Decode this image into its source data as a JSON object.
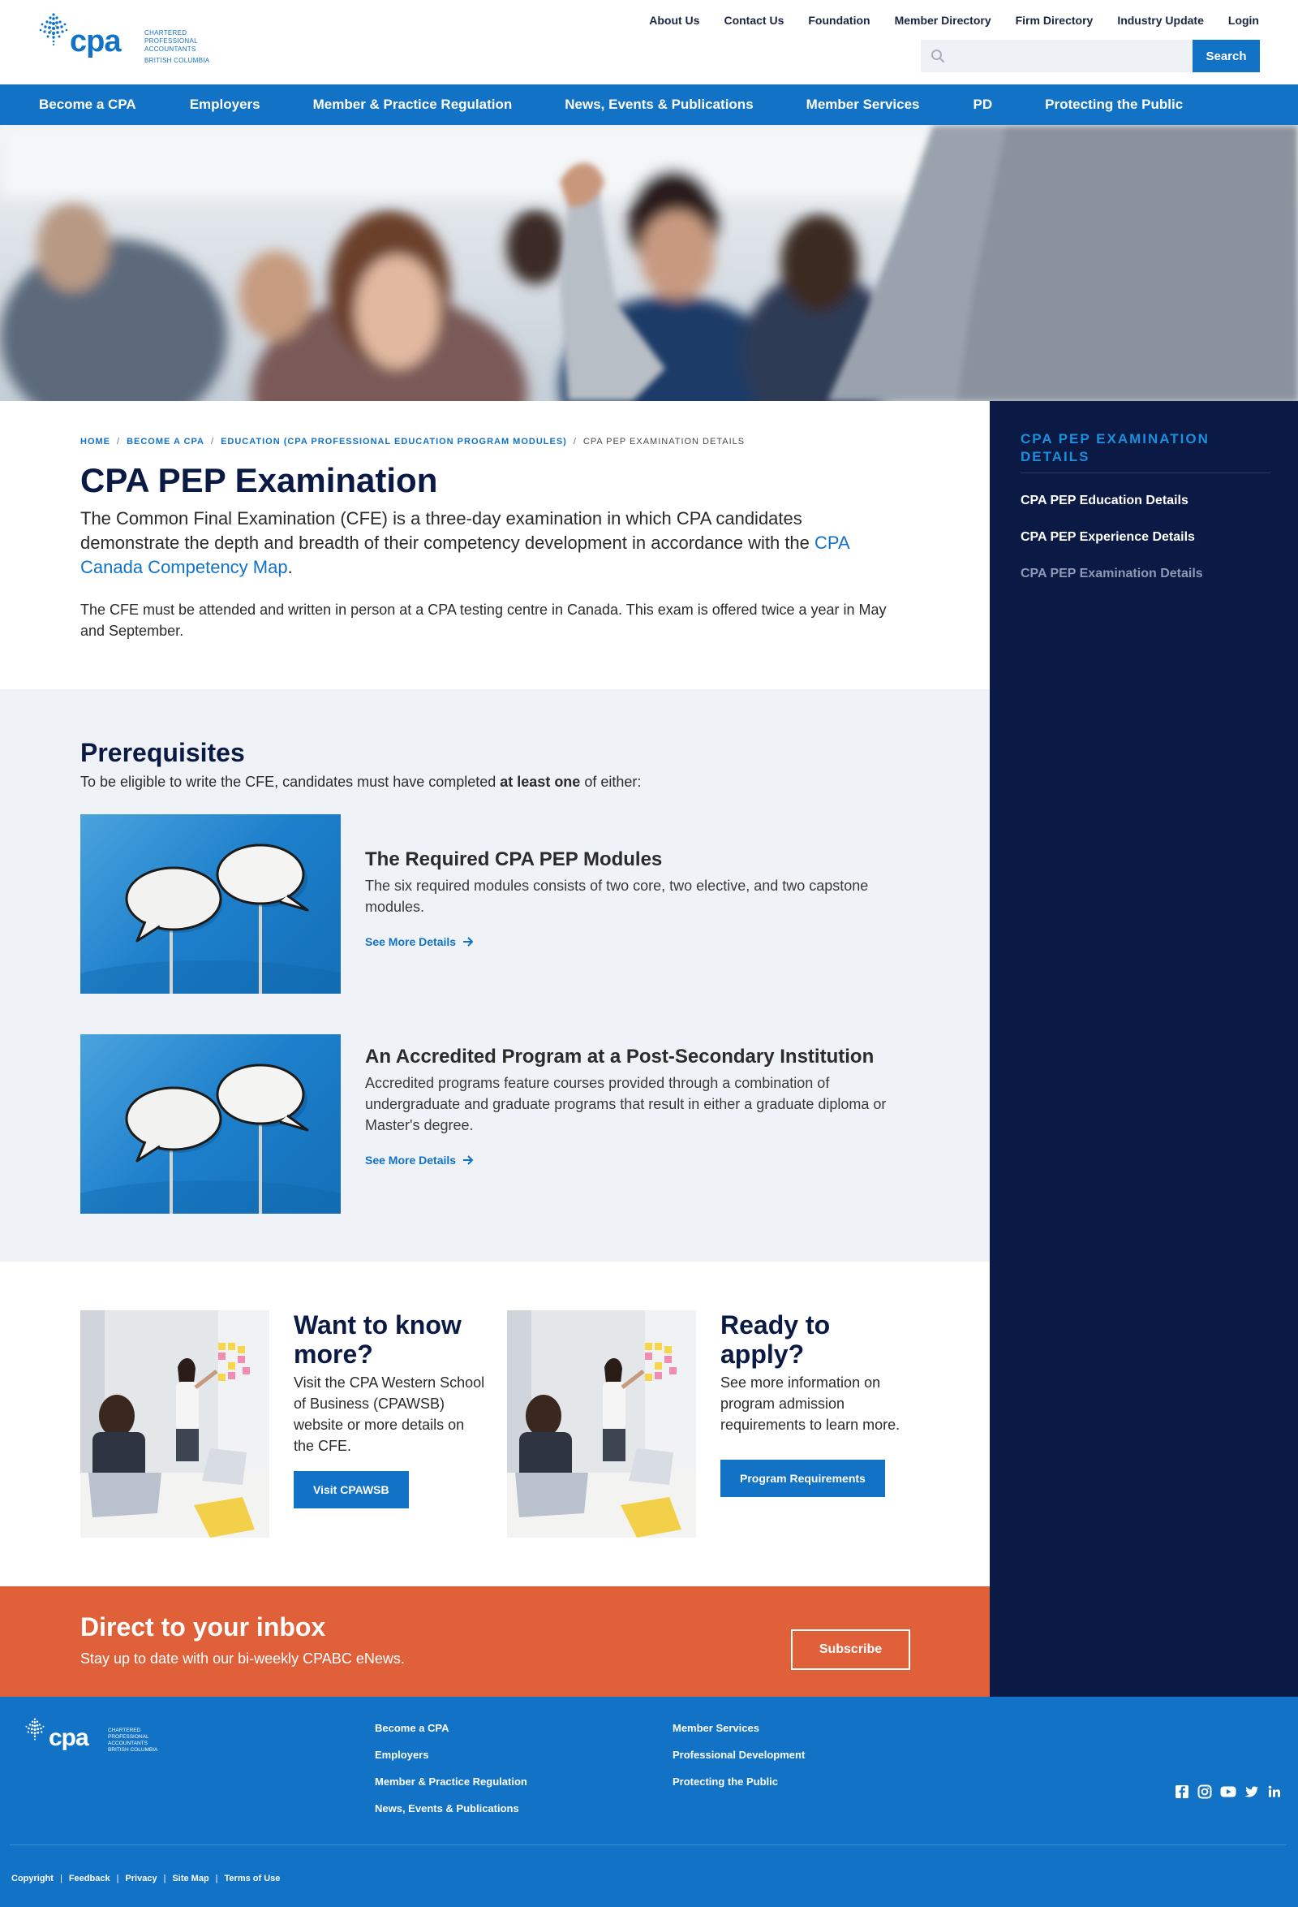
{
  "brand": {
    "logo_text": "cpa",
    "logo_line1": "Chartered",
    "logo_line2": "Professional",
    "logo_line3": "Accountants",
    "logo_region": "British Columbia",
    "primary": "#1172c6",
    "navy": "#0b1a44",
    "orange": "#e0603a"
  },
  "utility_nav": [
    "About Us",
    "Contact Us",
    "Foundation",
    "Member Directory",
    "Firm Directory",
    "Industry Update",
    "Login"
  ],
  "search": {
    "placeholder": "",
    "button": "Search"
  },
  "main_nav": [
    "Become a CPA",
    "Employers",
    "Member & Practice Regulation",
    "News, Events & Publications",
    "Member Services",
    "PD",
    "Protecting the Public"
  ],
  "breadcrumb": {
    "items": [
      "Home",
      "Become a CPA",
      "Education (CPA Professional Education Program Modules)"
    ],
    "current": "CPA PEP Examination Details",
    "separator": "/"
  },
  "page": {
    "title": "CPA PEP Examination",
    "lead_before": "The Common Final Examination (CFE) is a three-day examination in which CPA candidates demonstrate the depth and breadth of their competency development in accordance with the ",
    "lead_link": "CPA Canada Competency Map",
    "lead_after": ".",
    "body": "The CFE must be attended and written in person at a CPA testing centre in Canada. This exam is offered twice a year in May and September."
  },
  "sidebar": {
    "title": "CPA PEP Examination Details",
    "items": [
      "CPA PEP Education Details",
      "CPA PEP Experience Details",
      "CPA PEP Examination Details"
    ]
  },
  "prerequisites": {
    "heading": "Prerequisites",
    "intro_before": "To be eligible to write the CFE, candidates must have completed ",
    "intro_bold": "at least one",
    "intro_after": " of either:",
    "cards": [
      {
        "title": "The Required CPA PEP Modules",
        "text": "The six required modules consists of two core, two elective, and two capstone modules.",
        "link": "See More Details"
      },
      {
        "title": "An Accredited Program at a Post-Secondary Institution",
        "text": "Accredited programs feature courses provided through a combination of undergraduate and graduate programs that result in either a graduate diploma or Master's degree.",
        "link": "See More Details"
      }
    ]
  },
  "ctas": [
    {
      "title": "Want to know more?",
      "text": "Visit the CPA Western School of Business (CPAWSB) website or more details on the CFE.",
      "button": "Visit CPAWSB"
    },
    {
      "title": "Ready to apply?",
      "text": "See more information on program admission requirements to learn more.",
      "button": "Program Requirements"
    }
  ],
  "newsletter": {
    "title": "Direct to your inbox",
    "text": "Stay up to date with our bi-weekly CPABC eNews.",
    "button": "Subscribe"
  },
  "footer": {
    "col1": [
      "Become a CPA",
      "Employers",
      "Member & Practice Regulation",
      "News, Events & Publications"
    ],
    "col2": [
      "Member Services",
      "Professional Development",
      "Protecting the Public"
    ],
    "social": [
      "facebook-icon",
      "instagram-icon",
      "youtube-icon",
      "twitter-icon",
      "linkedin-icon"
    ],
    "legal": [
      "Copyright",
      "Feedback",
      "Privacy",
      "Site Map",
      "Terms of Use"
    ],
    "legal_separator": "|"
  }
}
